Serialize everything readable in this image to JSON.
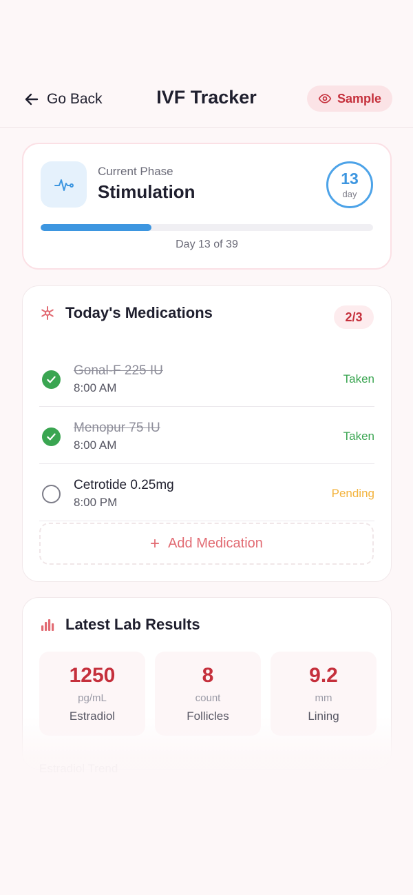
{
  "header": {
    "back_label": "Go Back",
    "title": "IVF Tracker",
    "sample_label": "Sample"
  },
  "phase": {
    "label": "Current Phase",
    "name": "Stimulation",
    "day_number": "13",
    "day_unit": "day",
    "progress_fraction": 0.333,
    "progress_text": "Day 13 of 39",
    "colors": {
      "accent": "#3d96e0",
      "icon_bg": "#e5f1fc"
    }
  },
  "medications": {
    "title": "Today's Medications",
    "count": "2/3",
    "items": [
      {
        "name": "Gonal-F 225 IU",
        "time": "8:00 AM",
        "status": "Taken",
        "taken": true
      },
      {
        "name": "Menopur 75 IU",
        "time": "8:00 AM",
        "status": "Taken",
        "taken": true
      },
      {
        "name": "Cetrotide 0.25mg",
        "time": "8:00 PM",
        "status": "Pending",
        "taken": false
      }
    ],
    "add_label": "Add Medication",
    "colors": {
      "taken": "#3aa551",
      "pending": "#f3b23b",
      "brand": "#c5303c"
    }
  },
  "lab_results": {
    "title": "Latest Lab Results",
    "tiles": [
      {
        "value": "1250",
        "unit": "pg/mL",
        "label": "Estradiol"
      },
      {
        "value": "8",
        "unit": "count",
        "label": "Follicles"
      },
      {
        "value": "9.2",
        "unit": "mm",
        "label": "Lining"
      }
    ],
    "trend_label": "Estradiol Trend"
  },
  "icons": {
    "back": "arrow-left-icon",
    "sample": "eye-icon",
    "phase": "heartbeat-icon",
    "medications": "asterisk-icon",
    "lab": "bar-chart-icon",
    "taken": "check-circle-icon",
    "pending": "empty-circle-icon",
    "add": "plus-icon"
  }
}
